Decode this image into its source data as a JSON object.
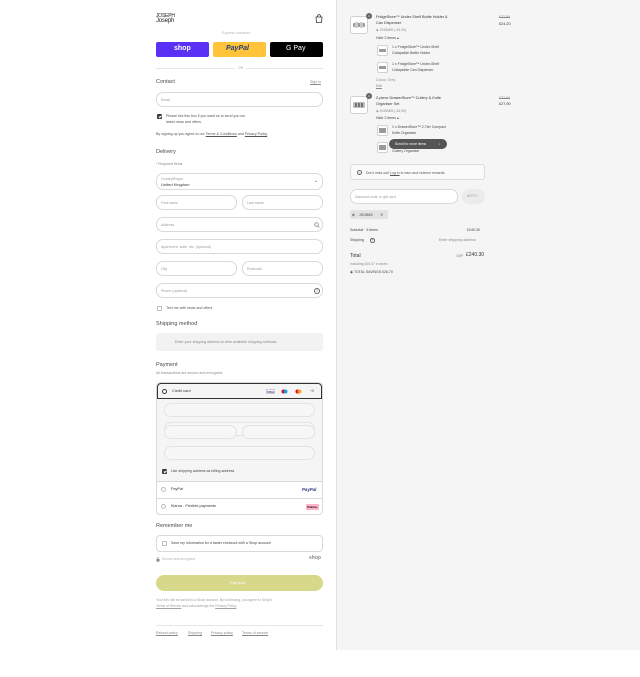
{
  "brand": {
    "logo_line1": "JOSEPH",
    "logo_line2": "Joseph"
  },
  "express": {
    "label": "Express checkout",
    "shop_label": "shop",
    "paypal_label": "PayPal",
    "gpay_label": "G Pay",
    "or_label": "OR"
  },
  "contact": {
    "heading": "Contact",
    "signin_label": "Sign in",
    "email_placeholder": "Email",
    "newsletter_label_1": "Please tick this box if you want us to send you our",
    "newsletter_label_2": "latest news and offers.",
    "terms_prefix": "By signing up you agree to our",
    "terms_link": "Terms & Conditions",
    "terms_and": "and",
    "privacy_link": "Privacy Policy"
  },
  "delivery": {
    "heading": "Delivery",
    "required_note": "* Required fields",
    "country_label": "Country/Region",
    "country_value": "United Kingdom",
    "first_name_placeholder": "First name",
    "last_name_placeholder": "Last name",
    "address_placeholder": "Address",
    "apartment_placeholder": "Apartment, suite, etc. (optional)",
    "city_placeholder": "City",
    "postcode_placeholder": "Postcode",
    "phone_placeholder": "Phone (optional)",
    "text_me_label": "Text me with news and offers"
  },
  "shipping": {
    "heading": "Shipping method",
    "placeholder": "Enter your shipping address to view available shipping methods."
  },
  "payment": {
    "heading": "Payment",
    "secure_note": "All transactions are secure and encrypted.",
    "credit_card_label": "Credit card",
    "more_cards": "+5",
    "billing_label": "Use shipping address as billing address",
    "paypal_label": "PayPal",
    "paypal_logo": "PayPal",
    "klarna_label": "Klarna - Flexible payments",
    "klarna_logo": "Klarna."
  },
  "remember": {
    "heading": "Remember me",
    "save_label": "Save my information for a faster checkout with a Shop account",
    "secure_label": "Secure and encrypted",
    "shop_logo": "shop"
  },
  "pay_button": "Pay now",
  "disclaimer_1": "Your info will be saved to a Shop account. By continuing, you agree to Shop's",
  "disclaimer_terms": "Terms of Service",
  "disclaimer_2": "and acknowledge the",
  "disclaimer_privacy": "Privacy Policy",
  "footer_links": [
    "Refund policy",
    "Shipping",
    "Privacy policy",
    "Terms of service"
  ],
  "cart": {
    "items": [
      {
        "qty": "1",
        "name_1": "FridgeStore™ Under-Shelf Bottle Holder &",
        "name_2": "Can Dispenser",
        "discount_tag": "JS15MIS (-£4.20)",
        "toggle": "Hide 2 items",
        "old_price": "£27.99",
        "price": "£24.20",
        "sub_items": [
          {
            "line1": "1 x FridgeStore™ Under-Shelf",
            "line2": "Collapsible Bottle Holder"
          },
          {
            "line1": "1 x FridgeStore™ Under-Shelf",
            "line2": "Collapsible Can Dispenser"
          }
        ],
        "colour_label": "Colour: Grey",
        "edit_label": "Edit"
      },
      {
        "qty": "1",
        "name_1": "2-piece DrawerStore™ Cutlery & Knife",
        "name_2": "Organiser Set",
        "discount_tag": "JS15MIS (-£4.90)",
        "toggle": "Hide 2 items",
        "old_price": "£32.90",
        "price": "£27.90",
        "sub_items": [
          {
            "line1": "1 x DrawerStore™ 2-Tier Compact",
            "line2": "Knife Organiser"
          },
          {
            "line1": "1 x DrawerStore™ Compact",
            "line2": "Cutlery Organiser"
          }
        ]
      }
    ],
    "scroll_tooltip": "Scroll for more items",
    "rewards_prefix": "Don't miss out!",
    "rewards_link": "Log in",
    "rewards_suffix": "to earn and redeem rewards",
    "discount_placeholder": "Discount code or gift card",
    "apply_label": "APPLY",
    "applied_code": "JS15MIS",
    "subtotal_label": "Subtotal · 5 items",
    "subtotal_value": "£240.30",
    "shipping_label": "Shipping",
    "shipping_value": "Enter shipping address",
    "total_label": "Total",
    "total_currency": "GBP",
    "total_value": "£240.30",
    "taxes_note": "Including £40.07 in taxes",
    "savings_label": "TOTAL SAVINGS",
    "savings_value": "£26.70"
  },
  "colors": {
    "shop": "#5a31f4",
    "paypal": "#ffc439",
    "gpay": "#000000",
    "pay_button": "#d8d88a"
  }
}
